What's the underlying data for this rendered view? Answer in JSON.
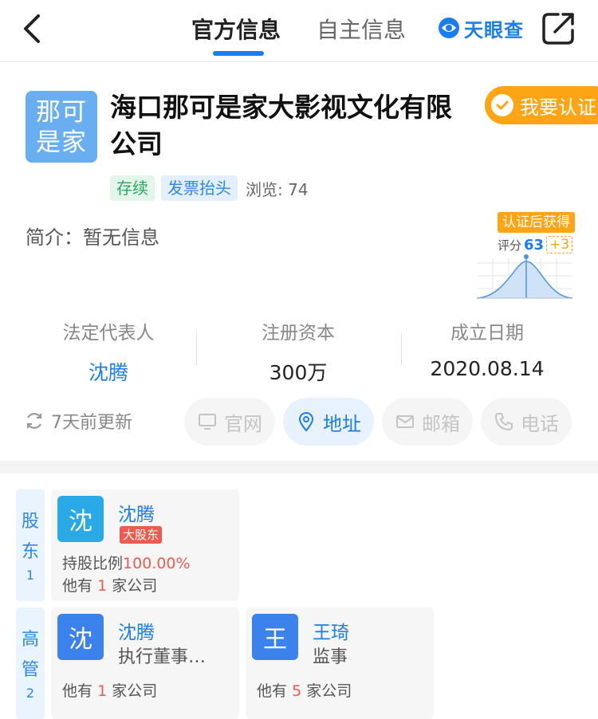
{
  "header": {
    "tabs": [
      {
        "label": "官方信息",
        "active": true
      },
      {
        "label": "自主信息",
        "active": false
      }
    ],
    "brand": "天眼查",
    "accent": "#1a7df0"
  },
  "company": {
    "logo_lines": [
      "那可",
      "是家"
    ],
    "name_lines": [
      "海口那可是家大影视文化有限",
      "公司"
    ],
    "verify_label": "我要认证",
    "tags": [
      "存续",
      "发票抬头"
    ],
    "views": "浏览: 74",
    "intro": "简介：暂无信息"
  },
  "score": {
    "badge": "认证后获得",
    "label": "评分",
    "value": "63",
    "bonus": "+3"
  },
  "stats": [
    {
      "label": "法定代表人",
      "value": "沈腾"
    },
    {
      "label": "注册资本",
      "value": "300万"
    },
    {
      "label": "成立日期",
      "value": "2020.08.14"
    }
  ],
  "update": "7天前更新",
  "contact_buttons": [
    {
      "label": "官网",
      "icon": "monitor-icon",
      "enabled": false
    },
    {
      "label": "地址",
      "icon": "location-icon",
      "enabled": true
    },
    {
      "label": "邮箱",
      "icon": "mail-icon",
      "enabled": false
    },
    {
      "label": "电话",
      "icon": "phone-icon",
      "enabled": false
    }
  ],
  "shareholders": {
    "side_label": [
      "股",
      "东"
    ],
    "count": "1",
    "items": [
      {
        "avatar": "沈",
        "name": "沈腾",
        "badge": "大股东",
        "ratio_label": "持股比例",
        "ratio": "100.00%",
        "prefix": "他有",
        "num": "1",
        "suffix": "家公司"
      }
    ]
  },
  "executives": {
    "side_label": [
      "高",
      "管"
    ],
    "count": "2",
    "items": [
      {
        "avatar": "沈",
        "name": "沈腾",
        "role": "执行董事…",
        "prefix": "他有",
        "num": "1",
        "suffix": "家公司"
      },
      {
        "avatar": "王",
        "name": "王琦",
        "role": "监事",
        "prefix": "他有",
        "num": "5",
        "suffix": "家公司"
      }
    ]
  }
}
